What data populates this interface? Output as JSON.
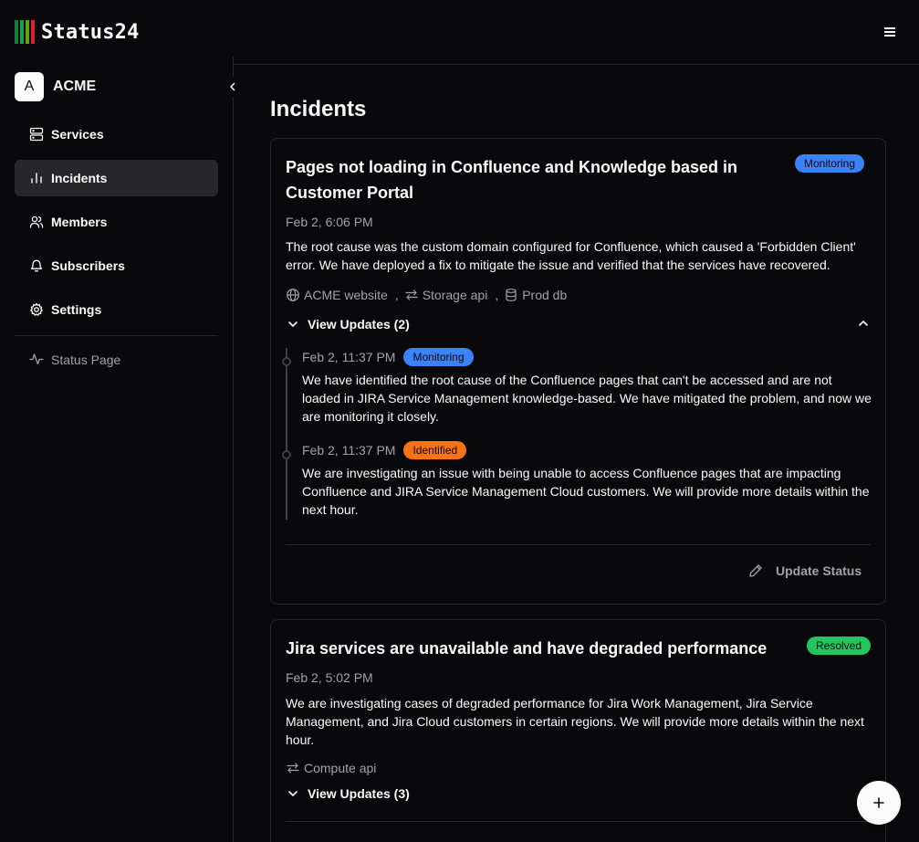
{
  "app": {
    "name": "Status24",
    "logo_colors": [
      "#16a34a",
      "#16a34a",
      "#84cc16",
      "#dc2626"
    ]
  },
  "org": {
    "initial": "A",
    "name": "ACME"
  },
  "sidebar": {
    "items": [
      {
        "label": "Services",
        "icon": "server-icon"
      },
      {
        "label": "Incidents",
        "icon": "bar-chart-icon",
        "active": true
      },
      {
        "label": "Members",
        "icon": "users-icon"
      },
      {
        "label": "Subscribers",
        "icon": "bell-icon"
      },
      {
        "label": "Settings",
        "icon": "gear-icon"
      }
    ],
    "status_page_label": "Status Page"
  },
  "main": {
    "title": "Incidents",
    "incidents": [
      {
        "title": "Pages not loading in Confluence and Knowledge based in Customer Portal",
        "status": "Monitoring",
        "time": "Feb 2, 6:06 PM",
        "description": "The root cause was the custom domain configured for Confluence, which caused a 'Forbidden Client' error. We have deployed a fix to mitigate the issue and verified that the services have recovered.",
        "services": [
          "ACME website",
          "Storage api",
          "Prod db"
        ],
        "view_updates_label": "View Updates (2)",
        "updates": [
          {
            "time": "Feb 2, 11:37 PM",
            "status": "Monitoring",
            "text": "We have identified the root cause of the Confluence pages that can't be accessed and are not loaded in JIRA Service Management knowledge-based. We have mitigated the problem, and now we are monitoring it closely."
          },
          {
            "time": "Feb 2, 11:37 PM",
            "status": "Identified",
            "text": "We are investigating an issue with being unable to access Confluence pages that are impacting Confluence and JIRA Service Management Cloud customers. We will provide more details within the next hour."
          }
        ],
        "update_status_label": "Update Status"
      },
      {
        "title": "Jira services are unavailable and have degraded performance",
        "status": "Resolved",
        "time": "Feb 2, 5:02 PM",
        "description": "We are investigating cases of degraded performance for Jira Work Management, Jira Service Management, and Jira Cloud customers in certain regions. We will provide more details within the next hour.",
        "services": [
          "Compute api"
        ],
        "view_updates_label": "View Updates (3)"
      }
    ]
  },
  "colors": {
    "background": "#09090b",
    "border": "#27272a",
    "muted_text": "#a1a1aa",
    "monitoring": "#3b82f6",
    "identified": "#f97316",
    "resolved": "#22c55e"
  }
}
